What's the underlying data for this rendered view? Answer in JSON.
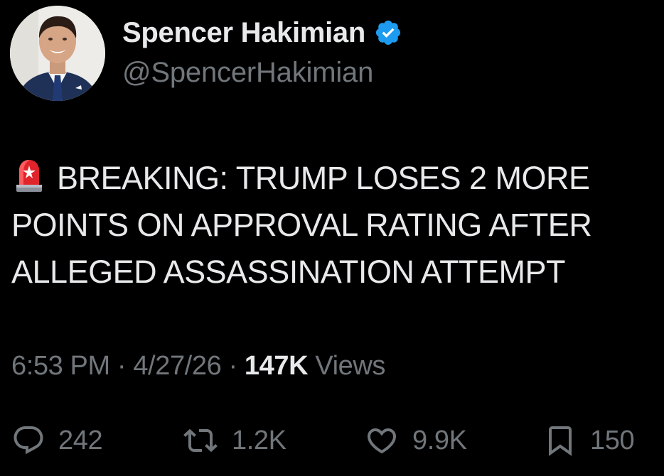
{
  "author": {
    "display_name": "Spencer Hakimian",
    "handle": "@SpencerHakimian",
    "verified": true,
    "verified_color": "#1d9bf0"
  },
  "tweet": {
    "siren_icon": "police-car-light-emoji",
    "text": "BREAKING: TRUMP LOSES 2 MORE POINTS ON APPROVAL RATING AFTER ALLEGED ASSASSINATION ATTEMPT"
  },
  "meta": {
    "time": "6:53 PM",
    "separator": "·",
    "date": "4/27/26",
    "views_count": "147K",
    "views_label": "Views"
  },
  "actions": {
    "replies": {
      "icon": "reply-icon",
      "count": "242"
    },
    "reposts": {
      "icon": "repost-icon",
      "count": "1.2K"
    },
    "likes": {
      "icon": "heart-icon",
      "count": "9.9K"
    },
    "bookmarks": {
      "icon": "bookmark-icon",
      "count": "150"
    }
  },
  "colors": {
    "background": "#000000",
    "primary_text": "#e7e9ea",
    "secondary_text": "#71767b",
    "accent": "#1d9bf0"
  }
}
